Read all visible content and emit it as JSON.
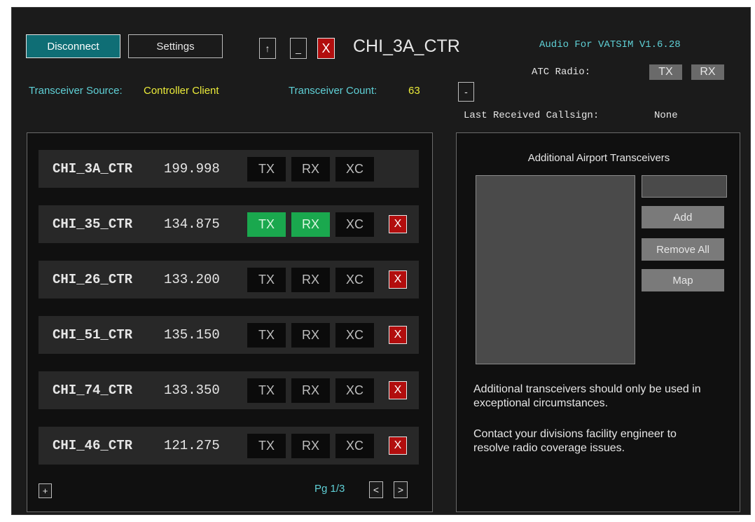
{
  "header": {
    "disconnect_label": "Disconnect",
    "settings_label": "Settings",
    "up_label": "↑",
    "minimize_label": "_",
    "close_label": "X",
    "callsign": "CHI_3A_CTR",
    "app_version": "Audio For VATSIM V1.6.28",
    "atc_radio_label": "ATC Radio:",
    "atc_tx": "TX",
    "atc_rx": "RX",
    "transceiver_source_label": "Transceiver Source:",
    "transceiver_source_value": "Controller Client",
    "transceiver_count_label": "Transceiver Count:",
    "transceiver_count_value": "63",
    "collapse_label": "-",
    "last_received_label": "Last Received Callsign:",
    "last_received_value": "None"
  },
  "stations": [
    {
      "name": "CHI_3A_CTR",
      "freq": "199.998",
      "tx": "TX",
      "rx": "RX",
      "xc": "XC",
      "tx_on": false,
      "rx_on": false,
      "removable": false
    },
    {
      "name": "CHI_35_CTR",
      "freq": "134.875",
      "tx": "TX",
      "rx": "RX",
      "xc": "XC",
      "tx_on": true,
      "rx_on": true,
      "removable": true
    },
    {
      "name": "CHI_26_CTR",
      "freq": "133.200",
      "tx": "TX",
      "rx": "RX",
      "xc": "XC",
      "tx_on": false,
      "rx_on": false,
      "removable": true
    },
    {
      "name": "CHI_51_CTR",
      "freq": "135.150",
      "tx": "TX",
      "rx": "RX",
      "xc": "XC",
      "tx_on": false,
      "rx_on": false,
      "removable": true
    },
    {
      "name": "CHI_74_CTR",
      "freq": "133.350",
      "tx": "TX",
      "rx": "RX",
      "xc": "XC",
      "tx_on": false,
      "rx_on": false,
      "removable": true
    },
    {
      "name": "CHI_46_CTR",
      "freq": "121.275",
      "tx": "TX",
      "rx": "RX",
      "xc": "XC",
      "tx_on": false,
      "rx_on": false,
      "removable": true
    }
  ],
  "row_remove_label": "X",
  "station_footer": {
    "add_label": "+",
    "page_label": "Pg 1/3",
    "prev_label": "<",
    "next_label": ">"
  },
  "airport": {
    "title": "Additional Airport Transceivers",
    "input_value": "",
    "add_label": "Add",
    "remove_all_label": "Remove All",
    "map_label": "Map",
    "note1": "Additional transceivers should only be used in exceptional circumstances.",
    "note2": "Contact your divisions facility engineer to resolve radio coverage issues."
  },
  "colors": {
    "accent_cyan": "#5fd0d6",
    "accent_yellow": "#ecec3a",
    "active_green": "#1aa84e",
    "danger_red": "#b20e0e",
    "disconnect_teal": "#0f6e75"
  }
}
